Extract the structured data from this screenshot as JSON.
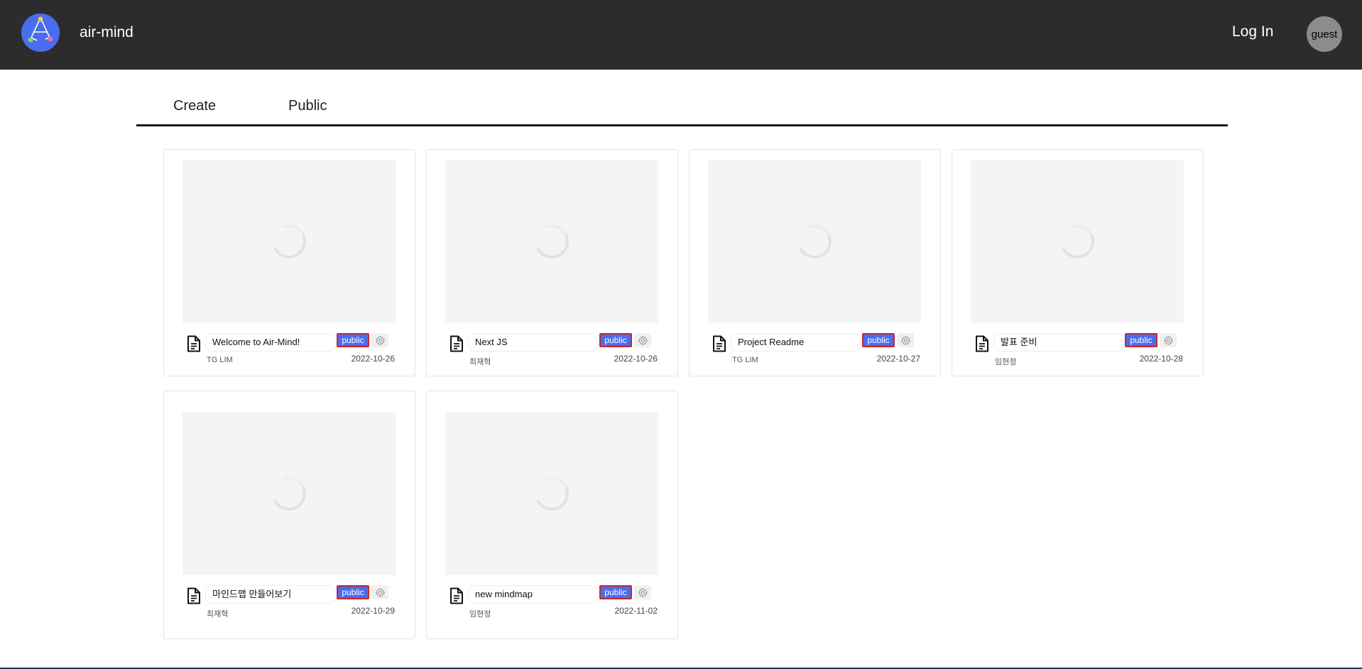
{
  "header": {
    "app_name": "air-mind",
    "login_label": "Log In",
    "avatar_label": "guest"
  },
  "tabs": [
    {
      "label": "Create"
    },
    {
      "label": "Public"
    }
  ],
  "cards": [
    {
      "title": "Welcome to Air-Mind!",
      "author": "TG LIM",
      "visibility": "public",
      "date": "2022-10-26"
    },
    {
      "title": "Next JS",
      "author": "최재혁",
      "visibility": "public",
      "date": "2022-10-26"
    },
    {
      "title": "Project Readme",
      "author": "TG LIM",
      "visibility": "public",
      "date": "2022-10-27"
    },
    {
      "title": "발표 준비",
      "author": "임현정",
      "visibility": "public",
      "date": "2022-10-28"
    },
    {
      "title": "마인드맵 만들어보기",
      "author": "최재혁",
      "visibility": "public",
      "date": "2022-10-29"
    },
    {
      "title": "new mindmap",
      "author": "임현정",
      "visibility": "public",
      "date": "2022-11-02"
    }
  ],
  "colors": {
    "header_bg": "#2c2c2c",
    "accent": "#4a6cf0",
    "badge_border": "#c62828"
  }
}
